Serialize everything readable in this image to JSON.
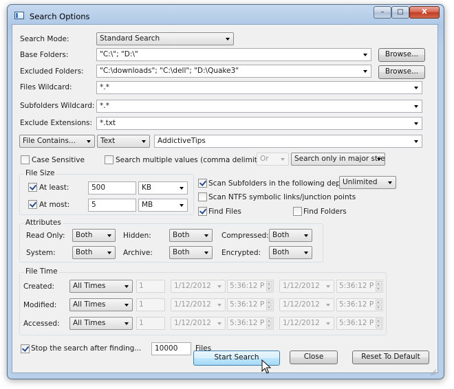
{
  "window": {
    "title": "Search Options",
    "minimize_glyph": "–",
    "maximize_glyph": "□",
    "close_glyph": "X"
  },
  "labels": {
    "search_mode": "Search Mode:",
    "base_folders": "Base Folders:",
    "excluded_folders": "Excluded Folders:",
    "files_wildcard": "Files Wildcard:",
    "subfolders_wildcard": "Subfolders Wildcard:",
    "exclude_extensions": "Exclude Extensions:"
  },
  "fields": {
    "search_mode": "Standard Search",
    "base_folders": "\"C:\\\"; \"D:\\\"",
    "excluded_folders": "\"C:\\downloads\"; \"C:\\dell\"; \"D:\\Quake3\"",
    "files_wildcard": "*.*",
    "subfolders_wildcard": "*.*",
    "exclude_extensions": "*.txt"
  },
  "buttons": {
    "browse_base": "Browse...",
    "browse_excluded": "Browse...",
    "start_search": "Start Search",
    "close": "Close",
    "reset": "Reset To Default"
  },
  "contains": {
    "mode": "File Contains...",
    "type": "Text",
    "value": "AddictiveTips"
  },
  "options": {
    "case_sensitive": "Case Sensitive",
    "case_sensitive_checked": false,
    "multiple_values": "Search multiple values (comma delimited)",
    "multiple_values_checked": false,
    "logic": "Or",
    "streams": "Search only in major streä"
  },
  "file_size": {
    "title": "File Size",
    "at_least_label": "At least:",
    "at_least_checked": true,
    "at_least_value": "500",
    "at_least_unit": "KB",
    "at_most_label": "At most:",
    "at_most_checked": true,
    "at_most_value": "5",
    "at_most_unit": "MB"
  },
  "scan": {
    "subfolders_label": "Scan Subfolders in the following depth:",
    "subfolders_checked": true,
    "depth": "Unlimited",
    "ntfs_label": "Scan NTFS symbolic links/junction points",
    "ntfs_checked": false,
    "find_files_label": "Find Files",
    "find_files_checked": true,
    "find_folders_label": "Find Folders",
    "find_folders_checked": false
  },
  "attributes": {
    "title": "Attributes",
    "read_only_label": "Read Only:",
    "read_only": "Both",
    "hidden_label": "Hidden:",
    "hidden": "Both",
    "compressed_label": "Compressed:",
    "compressed": "Both",
    "system_label": "System:",
    "system": "Both",
    "archive_label": "Archive:",
    "archive": "Both",
    "encrypted_label": "Encrypted:",
    "encrypted": "Both"
  },
  "file_time": {
    "title": "File Time",
    "rows": [
      {
        "label": "Created:",
        "mode": "All Times",
        "count": "1",
        "date1": "1/12/2012",
        "time1": "5:36:12 P",
        "date2": "1/12/2012",
        "time2": "5:36:12 P"
      },
      {
        "label": "Modified:",
        "mode": "All Times",
        "count": "1",
        "date1": "1/12/2012",
        "time1": "5:36:12 P",
        "date2": "1/12/2012",
        "time2": "5:36:12 P"
      },
      {
        "label": "Accessed:",
        "mode": "All Times",
        "count": "1",
        "date1": "1/12/2012",
        "time1": "5:36:12 P",
        "date2": "1/12/2012",
        "time2": "5:36:12 P"
      }
    ]
  },
  "stop": {
    "label": "Stop the search after finding...",
    "checked": true,
    "value": "10000",
    "unit": "Files"
  }
}
